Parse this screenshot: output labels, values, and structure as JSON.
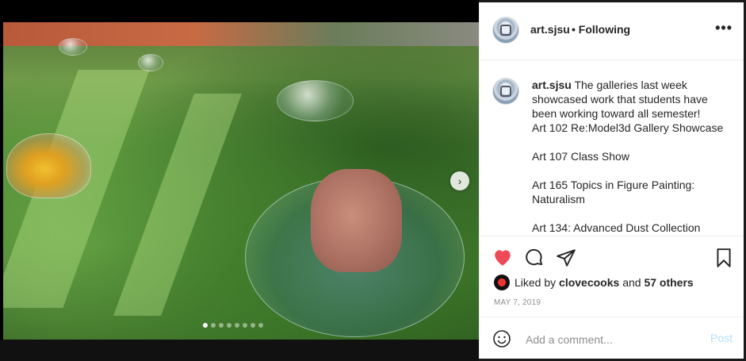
{
  "post": {
    "username": "art.sjsu",
    "follow_status": "• Following",
    "more_label": "•••",
    "caption_username": "art.sjsu",
    "caption_text": " The galleries last week showcased work that students have been working toward all semester!\nArt 102 Re:Model3d Gallery Showcase\n\nArt 107 Class Show\n\nArt 165 Topics in Figure Painting: Naturalism\n\nArt 134: Advanced Dust Collection",
    "likes": {
      "prefix": "Liked by ",
      "liked_by": "clovecooks",
      "middle": " and ",
      "others": "57 others"
    },
    "date": "MAY 7, 2019",
    "carousel": {
      "slide_count": 8,
      "active_index": 0,
      "next_icon": "chevron-right-icon"
    },
    "colors": {
      "like": "#ed4956",
      "post_button": "#b2dffc",
      "text": "#262626",
      "muted": "#8e8e8e"
    }
  },
  "comment": {
    "placeholder": "Add a comment...",
    "post_label": "Post"
  }
}
